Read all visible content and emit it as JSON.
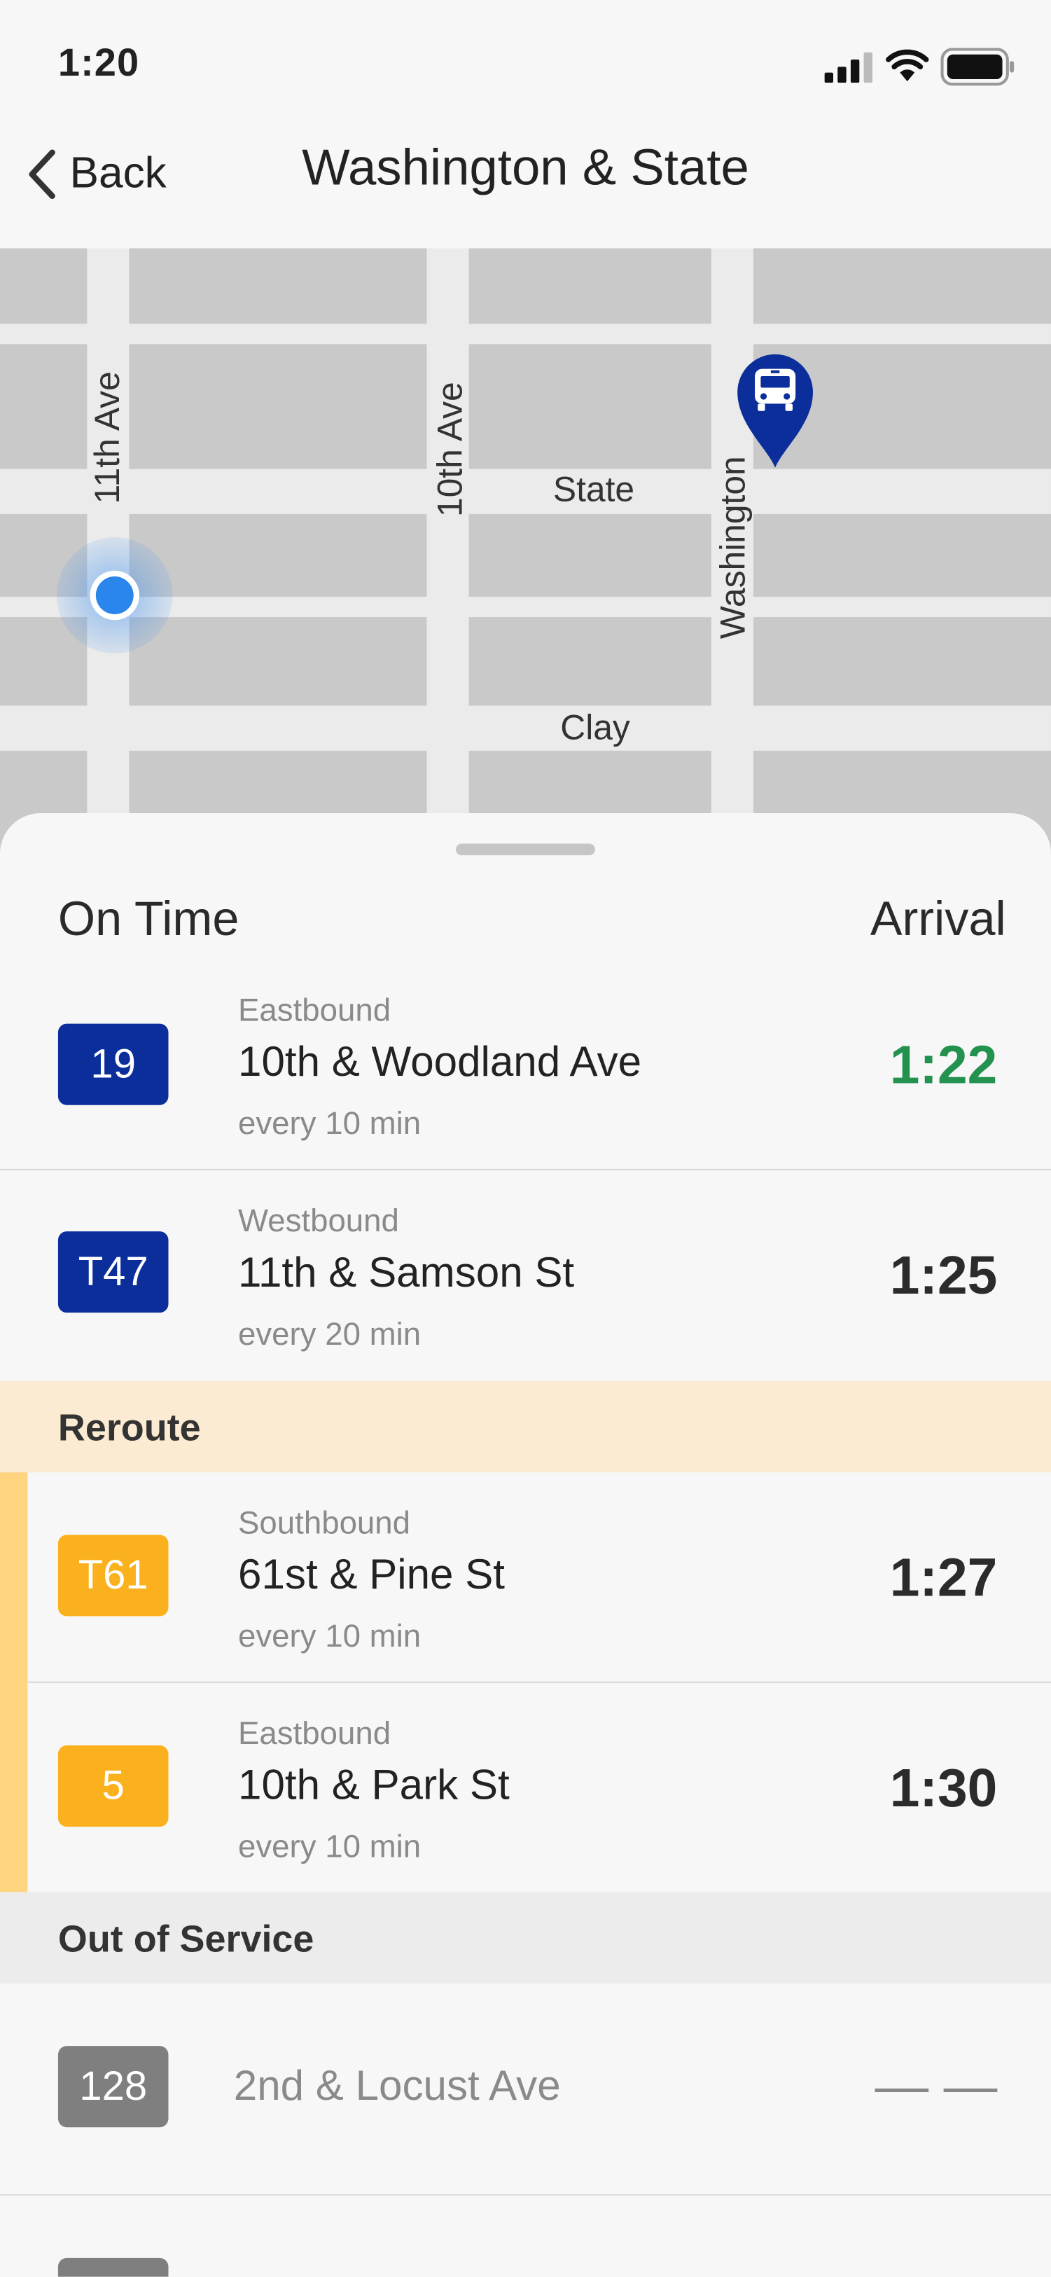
{
  "status_bar": {
    "time": "1:20"
  },
  "nav": {
    "back_label": "Back",
    "title": "Washington & State"
  },
  "map": {
    "streets": {
      "avenue_11": "11th Ave",
      "avenue_10": "10th Ave",
      "washington": "Washington",
      "state": "State",
      "clay": "Clay"
    },
    "bus_stop_icon": "bus-stop-pin-icon",
    "location_icon": "current-location-icon"
  },
  "colors": {
    "navy": "#0b2e9b",
    "reroute_orange": "#fbb11d",
    "reroute_band": "#fbebd2",
    "on_time_green": "#22924e",
    "out_of_service_gray": "#7f7f7f",
    "location_blue": "#2a86ec"
  },
  "headers": {
    "status": "On Time",
    "arrival": "Arrival"
  },
  "on_time": [
    {
      "route": "19",
      "direction": "Eastbound",
      "destination": "10th & Woodland Ave",
      "frequency": "every 10 min",
      "arrival": "1:22"
    },
    {
      "route": "T47",
      "direction": "Westbound",
      "destination": "11th & Samson St",
      "frequency": "every 20 min",
      "arrival": "1:25"
    }
  ],
  "reroute": {
    "label": "Reroute",
    "routes": [
      {
        "route": "T61",
        "direction": "Southbound",
        "destination": "61st & Pine St",
        "frequency": "every 10 min",
        "arrival": "1:27"
      },
      {
        "route": "5",
        "direction": "Eastbound",
        "destination": "10th & Park St",
        "frequency": "every 10 min",
        "arrival": "1:30"
      }
    ]
  },
  "out_of_service": {
    "label": "Out of Service",
    "routes": [
      {
        "route": "128",
        "destination": "2nd & Locust Ave",
        "arrival": "— —"
      }
    ]
  }
}
